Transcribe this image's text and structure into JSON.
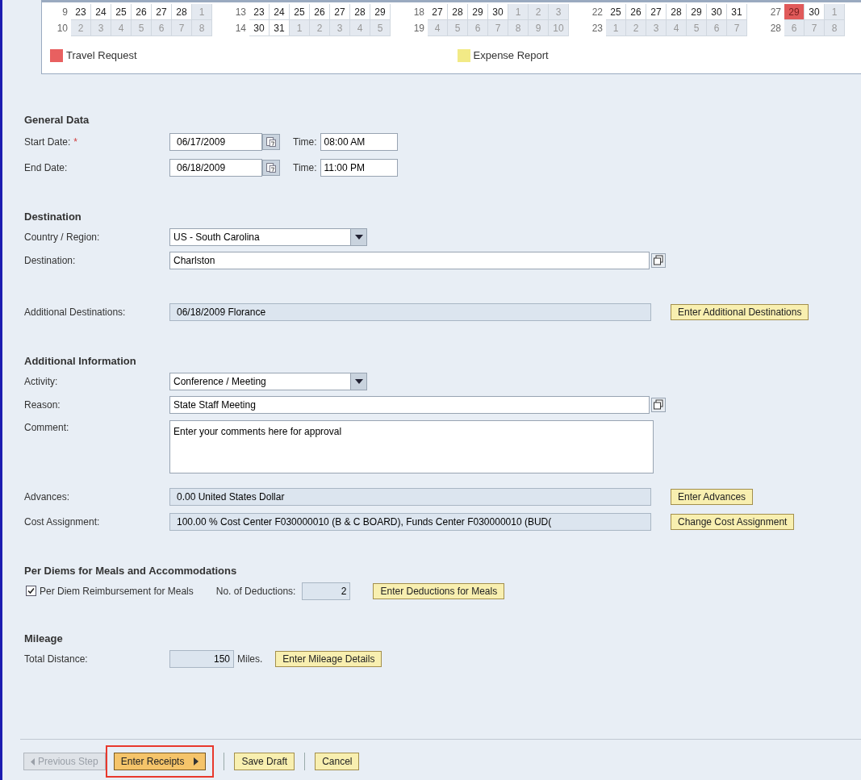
{
  "calendar": {
    "months": [
      {
        "weeks": [
          {
            "number": "9",
            "days": [
              {
                "label": "23",
                "current": true,
                "marked": false
              },
              {
                "label": "24",
                "current": true,
                "marked": false
              },
              {
                "label": "25",
                "current": true,
                "marked": false
              },
              {
                "label": "26",
                "current": true,
                "marked": false
              },
              {
                "label": "27",
                "current": true,
                "marked": false
              },
              {
                "label": "28",
                "current": true,
                "marked": false
              },
              {
                "label": "1",
                "current": false,
                "marked": false
              }
            ]
          },
          {
            "number": "10",
            "days": [
              {
                "label": "2",
                "current": false,
                "marked": false
              },
              {
                "label": "3",
                "current": false,
                "marked": false
              },
              {
                "label": "4",
                "current": false,
                "marked": false
              },
              {
                "label": "5",
                "current": false,
                "marked": false
              },
              {
                "label": "6",
                "current": false,
                "marked": false
              },
              {
                "label": "7",
                "current": false,
                "marked": false
              },
              {
                "label": "8",
                "current": false,
                "marked": false
              }
            ]
          }
        ]
      },
      {
        "weeks": [
          {
            "number": "13",
            "days": [
              {
                "label": "23",
                "current": true,
                "marked": false
              },
              {
                "label": "24",
                "current": true,
                "marked": false
              },
              {
                "label": "25",
                "current": true,
                "marked": false
              },
              {
                "label": "26",
                "current": true,
                "marked": false
              },
              {
                "label": "27",
                "current": true,
                "marked": false
              },
              {
                "label": "28",
                "current": true,
                "marked": false
              },
              {
                "label": "29",
                "current": true,
                "marked": false
              }
            ]
          },
          {
            "number": "14",
            "days": [
              {
                "label": "30",
                "current": true,
                "marked": false
              },
              {
                "label": "31",
                "current": true,
                "marked": false
              },
              {
                "label": "1",
                "current": false,
                "marked": false
              },
              {
                "label": "2",
                "current": false,
                "marked": false
              },
              {
                "label": "3",
                "current": false,
                "marked": false
              },
              {
                "label": "4",
                "current": false,
                "marked": false
              },
              {
                "label": "5",
                "current": false,
                "marked": false
              }
            ]
          }
        ]
      },
      {
        "weeks": [
          {
            "number": "18",
            "days": [
              {
                "label": "27",
                "current": true,
                "marked": false
              },
              {
                "label": "28",
                "current": true,
                "marked": false
              },
              {
                "label": "29",
                "current": true,
                "marked": false
              },
              {
                "label": "30",
                "current": true,
                "marked": false
              },
              {
                "label": "1",
                "current": false,
                "marked": false
              },
              {
                "label": "2",
                "current": false,
                "marked": false
              },
              {
                "label": "3",
                "current": false,
                "marked": false
              }
            ]
          },
          {
            "number": "19",
            "days": [
              {
                "label": "4",
                "current": false,
                "marked": false
              },
              {
                "label": "5",
                "current": false,
                "marked": false
              },
              {
                "label": "6",
                "current": false,
                "marked": false
              },
              {
                "label": "7",
                "current": false,
                "marked": false
              },
              {
                "label": "8",
                "current": false,
                "marked": false
              },
              {
                "label": "9",
                "current": false,
                "marked": false
              },
              {
                "label": "10",
                "current": false,
                "marked": false
              }
            ]
          }
        ]
      },
      {
        "weeks": [
          {
            "number": "22",
            "days": [
              {
                "label": "25",
                "current": true,
                "marked": false
              },
              {
                "label": "26",
                "current": true,
                "marked": false
              },
              {
                "label": "27",
                "current": true,
                "marked": false
              },
              {
                "label": "28",
                "current": true,
                "marked": false
              },
              {
                "label": "29",
                "current": true,
                "marked": false
              },
              {
                "label": "30",
                "current": true,
                "marked": false
              },
              {
                "label": "31",
                "current": true,
                "marked": false
              }
            ]
          },
          {
            "number": "23",
            "days": [
              {
                "label": "1",
                "current": false,
                "marked": false
              },
              {
                "label": "2",
                "current": false,
                "marked": false
              },
              {
                "label": "3",
                "current": false,
                "marked": false
              },
              {
                "label": "4",
                "current": false,
                "marked": false
              },
              {
                "label": "5",
                "current": false,
                "marked": false
              },
              {
                "label": "6",
                "current": false,
                "marked": false
              },
              {
                "label": "7",
                "current": false,
                "marked": false
              }
            ]
          }
        ]
      },
      {
        "weeks": [
          {
            "number": "27",
            "days": [
              {
                "label": "29",
                "current": true,
                "marked": true
              },
              {
                "label": "30",
                "current": true,
                "marked": false
              },
              {
                "label": "1",
                "current": false,
                "marked": false
              }
            ]
          },
          {
            "number": "28",
            "days": [
              {
                "label": "6",
                "current": false,
                "marked": false
              },
              {
                "label": "7",
                "current": false,
                "marked": false
              },
              {
                "label": "8",
                "current": false,
                "marked": false
              }
            ]
          }
        ]
      }
    ],
    "legend": [
      {
        "label": "Travel Request",
        "color": "#e86060"
      },
      {
        "label": "Expense Report",
        "color": "#f2ea86"
      }
    ]
  },
  "sections": [
    {
      "title": "General Data",
      "rows": [
        {
          "kind": "date_time",
          "label": "Start Date:",
          "required": true,
          "required_mark": "*",
          "date": "06/17/2009",
          "time_label": "Time:",
          "time": "08:00 AM"
        },
        {
          "kind": "date_time",
          "label": "End Date:",
          "date": "06/18/2009",
          "time_label": "Time:",
          "time": "11:00 PM"
        }
      ]
    },
    {
      "title": "Destination",
      "rows": [
        {
          "kind": "dropdown",
          "label": "Country / Region:",
          "value": "US - South Carolina"
        },
        {
          "kind": "value_help",
          "label": "Destination:",
          "value": "Charlston"
        }
      ]
    },
    {
      "rows": [
        {
          "kind": "readonly",
          "label": "Additional Destinations:",
          "value": "06/18/2009 Florance",
          "button": "Enter Additional Destinations"
        }
      ]
    },
    {
      "title": "Additional Information",
      "rows": [
        {
          "kind": "dropdown",
          "label": "Activity:",
          "value": "Conference / Meeting"
        },
        {
          "kind": "value_help",
          "label": "Reason:",
          "value": "State Staff Meeting"
        },
        {
          "kind": "textarea",
          "label": "Comment:",
          "value": "Enter your comments here for approval"
        },
        {
          "kind": "readonly",
          "label": "Advances:",
          "value": "0.00 United States Dollar",
          "button": "Enter Advances"
        },
        {
          "kind": "readonly",
          "label": "Cost Assignment:",
          "value": "100.00 % Cost Center F030000010 (B & C BOARD), Funds Center F030000010 (BUD(",
          "button": "Change Cost Assignment"
        }
      ]
    },
    {
      "title": "Per Diems for Meals and Accommodations",
      "rows": [
        {
          "kind": "checkbox",
          "label": "Per Diem Reimbursement for Meals",
          "checked": true,
          "count_label": "No. of Deductions:",
          "count": "2",
          "button": "Enter Deductions for Meals"
        }
      ]
    },
    {
      "title": "Mileage",
      "rows": [
        {
          "kind": "distance",
          "label": "Total Distance:",
          "value": "150",
          "unit": "Miles.",
          "button": "Enter Mileage Details"
        }
      ]
    }
  ],
  "footer": [
    {
      "kind": "back",
      "label": "Previous Step",
      "disabled": true,
      "callout": false
    },
    {
      "kind": "next",
      "label": "Enter Receipts",
      "disabled": false,
      "callout": true
    },
    {
      "kind": "plain",
      "label": "Save Draft",
      "disabled": false,
      "callout": false
    },
    {
      "kind": "plain",
      "label": "Cancel",
      "disabled": false,
      "callout": false
    }
  ]
}
